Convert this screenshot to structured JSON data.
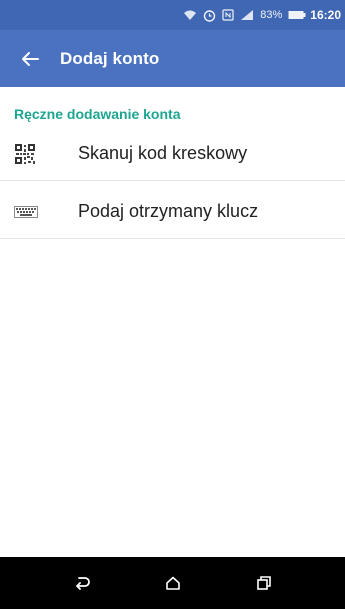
{
  "status_bar": {
    "clock": "16:20",
    "battery_percent": "83%",
    "icons": [
      "wifi-icon",
      "alarm-icon",
      "nfc-icon",
      "signal-icon",
      "battery-icon"
    ]
  },
  "app_bar": {
    "title": "Dodaj konto",
    "back_icon": "arrow-left-icon"
  },
  "section": {
    "title": "Ręczne dodawanie konta",
    "items": [
      {
        "label": "Skanuj kod kreskowy",
        "icon": "qr-code-icon"
      },
      {
        "label": "Podaj otrzymany klucz",
        "icon": "keyboard-icon"
      }
    ]
  },
  "nav_bar": {
    "buttons": [
      "back-icon",
      "home-icon",
      "recents-icon"
    ]
  },
  "colors": {
    "status_bar": "#3f67b3",
    "app_bar": "#4a72c0",
    "section_header": "#1da591",
    "nav_bar": "#000000"
  }
}
